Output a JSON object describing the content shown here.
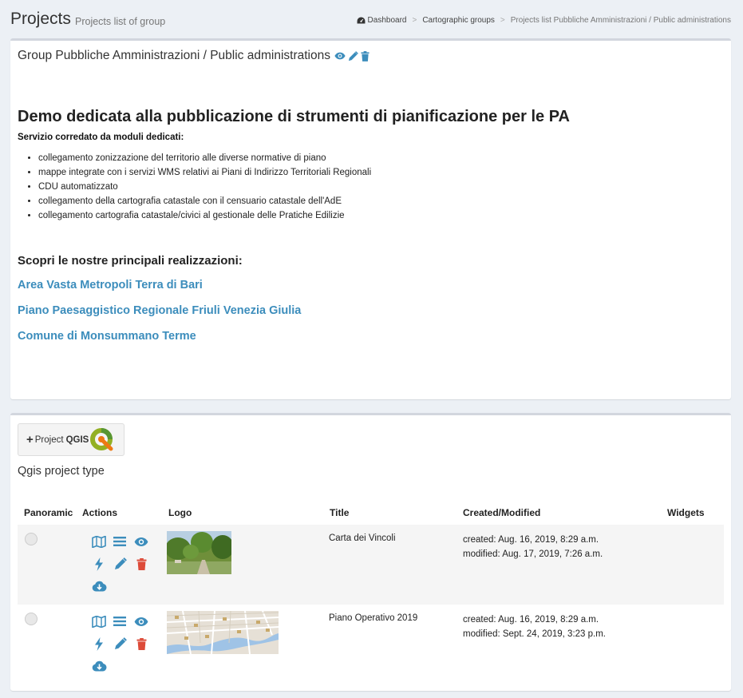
{
  "header": {
    "title": "Projects",
    "subtitle": "Projects list of group",
    "breadcrumb": [
      "Dashboard",
      "Cartographic groups",
      "Projects list Pubbliche Amministrazioni / Public administrations"
    ]
  },
  "group": {
    "name": "Group Pubbliche Amministrazioni / Public administrations",
    "icons": [
      "eye-icon",
      "pencil-icon",
      "trash-icon"
    ]
  },
  "description": {
    "title": "Demo dedicata alla pubblicazione di strumenti di pianificazione per le PA",
    "subtitle": "Servizio corredato da moduli dedicati:",
    "items": [
      "collegamento zonizzazione del territorio alle diverse normative di piano",
      "mappe integrate con i servizi WMS relativi ai Piani di Indirizzo Territoriali Regionali",
      "CDU automatizzato",
      "collegamento della cartografia catastale con il censuario catastale dell'AdE",
      "collegamento cartografia catastale/civici al gestionale delle Pratiche Edilizie"
    ],
    "discover": "Scopri le nostre principali realizzazioni:",
    "links": [
      "Area Vasta Metropoli Terra di Bari",
      "Piano Paesaggistico Regionale Friuli Venezia Giulia",
      "Comune di Monsummano Terme"
    ]
  },
  "projects_panel": {
    "add_button": {
      "prefix": "Project",
      "qgis": "QGIS"
    },
    "type_label": "Qgis project type",
    "columns": [
      "Panoramic",
      "Actions",
      "Logo",
      "Title",
      "Created/Modified",
      "Widgets"
    ],
    "rows": [
      {
        "title": "Carta dei Vincoli",
        "created": "created: Aug. 16, 2019, 8:29 a.m.",
        "modified": "modified: Aug. 17, 2019, 7:26 a.m.",
        "logo": "park-photo"
      },
      {
        "title": "Piano Operativo 2019",
        "created": "created: Aug. 16, 2019, 8:29 a.m.",
        "modified": "modified: Sept. 24, 2019, 3:23 p.m.",
        "logo": "city-map"
      }
    ]
  },
  "colors": {
    "accent": "#3c8dbc",
    "danger": "#dd4b39",
    "background": "#ecf0f5",
    "qgis_green": "#589632",
    "qgis_yellow": "#ee7913"
  }
}
